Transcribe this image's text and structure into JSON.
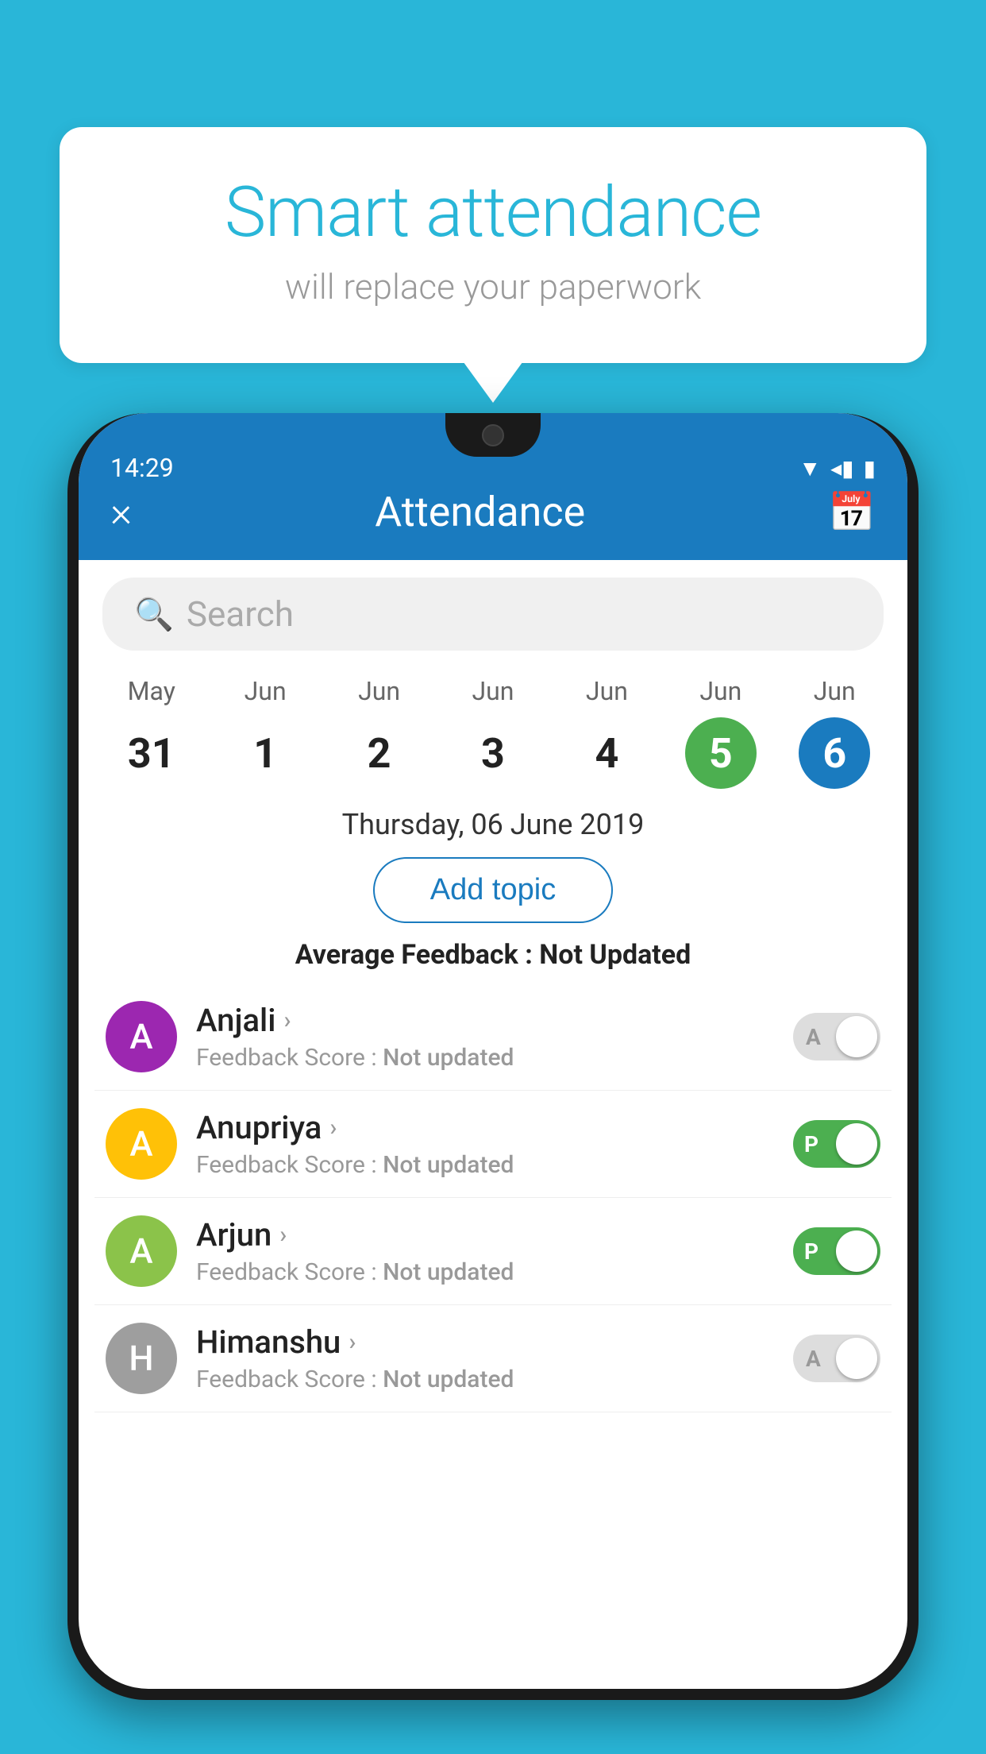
{
  "background_color": "#29B6D8",
  "speech_bubble": {
    "title": "Smart attendance",
    "subtitle": "will replace your paperwork"
  },
  "phone": {
    "status_bar": {
      "time": "14:29",
      "wifi_icon": "▼",
      "signal_icon": "◂",
      "battery_icon": "▮"
    },
    "app_header": {
      "title": "Attendance",
      "close_label": "×",
      "calendar_icon": "🗓"
    },
    "search": {
      "placeholder": "Search"
    },
    "calendar": {
      "days": [
        {
          "month": "May",
          "num": "31",
          "state": "normal"
        },
        {
          "month": "Jun",
          "num": "1",
          "state": "normal"
        },
        {
          "month": "Jun",
          "num": "2",
          "state": "normal"
        },
        {
          "month": "Jun",
          "num": "3",
          "state": "normal"
        },
        {
          "month": "Jun",
          "num": "4",
          "state": "normal"
        },
        {
          "month": "Jun",
          "num": "5",
          "state": "today"
        },
        {
          "month": "Jun",
          "num": "6",
          "state": "selected"
        }
      ]
    },
    "selected_date": "Thursday, 06 June 2019",
    "add_topic_label": "Add topic",
    "average_feedback": {
      "label": "Average Feedback : ",
      "value": "Not Updated"
    },
    "students": [
      {
        "name": "Anjali",
        "avatar_letter": "A",
        "avatar_color": "#9C27B0",
        "feedback": "Not updated",
        "toggle_state": "off",
        "toggle_label": "A"
      },
      {
        "name": "Anupriya",
        "avatar_letter": "A",
        "avatar_color": "#FFC107",
        "feedback": "Not updated",
        "toggle_state": "on",
        "toggle_label": "P"
      },
      {
        "name": "Arjun",
        "avatar_letter": "A",
        "avatar_color": "#8BC34A",
        "feedback": "Not updated",
        "toggle_state": "on",
        "toggle_label": "P"
      },
      {
        "name": "Himanshu",
        "avatar_letter": "H",
        "avatar_color": "#9E9E9E",
        "feedback": "Not updated",
        "toggle_state": "off",
        "toggle_label": "A"
      }
    ],
    "feedback_score_label": "Feedback Score : "
  }
}
